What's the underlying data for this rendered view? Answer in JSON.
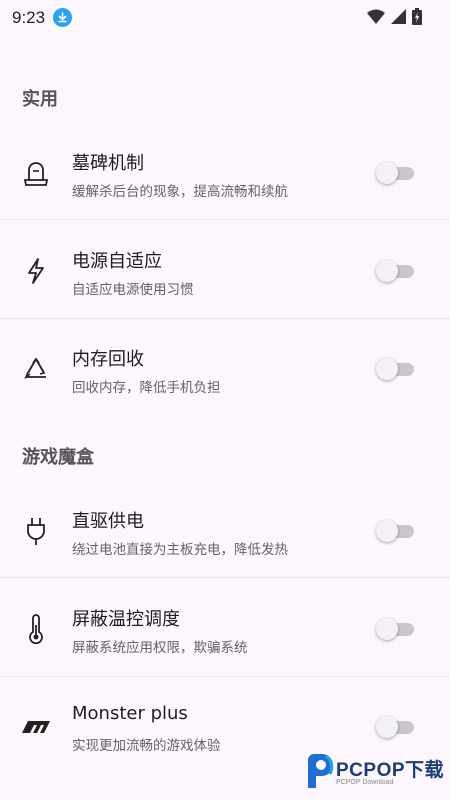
{
  "status_bar": {
    "time": "9:23",
    "icons": [
      "download-icon",
      "wifi-icon",
      "signal-icon",
      "battery-icon"
    ]
  },
  "sections": [
    {
      "header": "实用",
      "items": [
        {
          "title": "墓碑机制",
          "subtitle": "缓解杀后台的现象，提高流畅和续航",
          "icon": "tombstone-icon",
          "enabled": false
        },
        {
          "title": "电源自适应",
          "subtitle": "自适应电源使用习惯",
          "icon": "lightning-icon",
          "enabled": false
        },
        {
          "title": "内存回收",
          "subtitle": "回收内存，降低手机负担",
          "icon": "recycle-icon",
          "enabled": false
        }
      ]
    },
    {
      "header": "游戏魔盒",
      "items": [
        {
          "title": "直驱供电",
          "subtitle": "绕过电池直接为主板充电，降低发热",
          "icon": "plug-icon",
          "enabled": false
        },
        {
          "title": "屏蔽温控调度",
          "subtitle": "屏蔽系统应用权限，欺骗系统",
          "icon": "thermometer-icon",
          "enabled": false
        },
        {
          "title": "Monster plus",
          "subtitle": "实现更加流畅的游戏体验",
          "icon": "monster-logo-icon",
          "enabled": false
        }
      ]
    }
  ],
  "watermark": {
    "brand": "PCPOP下载",
    "sub": "PCPOP Download"
  },
  "colors": {
    "background": "#fdf6fc",
    "toggle_track_off": "#c9c6cc",
    "header_text": "#56535a"
  }
}
